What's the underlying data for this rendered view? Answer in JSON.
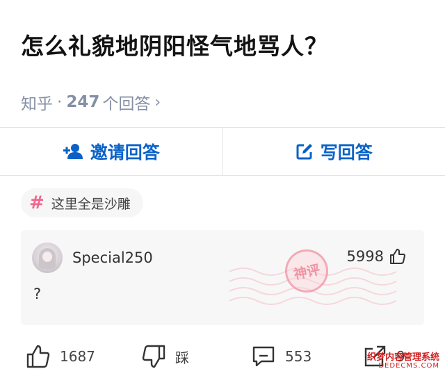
{
  "question": {
    "title": "怎么礼貌地阴阳怪气地骂人？",
    "source": "知乎",
    "separator": "·",
    "answer_count": "247",
    "answer_count_suffix": "个回答",
    "chevron": "›"
  },
  "actions": {
    "invite_label": "邀请回答",
    "write_label": "写回答"
  },
  "topic": {
    "hash_symbol": "#",
    "label": "这里全是沙雕"
  },
  "answer": {
    "author": "Special250",
    "upvotes": "5998",
    "content": "?",
    "stamp_text": "神评"
  },
  "bottom": {
    "likes": "1687",
    "dislike_label": "踩",
    "comments": "553",
    "share_count": "9"
  },
  "watermark": {
    "main": "织梦内容管理系统",
    "sub": "DEDECMS.COM"
  },
  "colors": {
    "accent": "#0a62c8",
    "topic_hash": "#f1678f",
    "meta_gray": "#8590a6",
    "watermark_red": "#d21f1f"
  },
  "icons": [
    "add-user-icon",
    "edit-icon",
    "hash-icon",
    "thumbs-up-icon",
    "thumbs-down-icon",
    "comment-icon",
    "share-icon"
  ]
}
